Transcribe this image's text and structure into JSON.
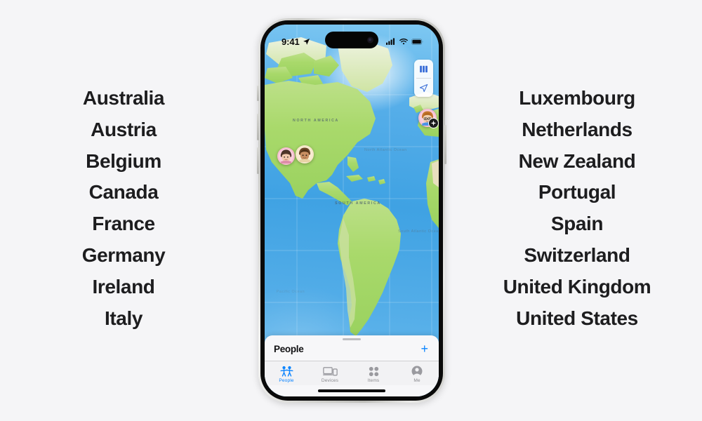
{
  "page": {
    "background_color": "#f5f5f7",
    "accent_color": "#0a84ff"
  },
  "left_column": {
    "name": "countries-left",
    "items": [
      {
        "label": "Australia"
      },
      {
        "label": "Austria"
      },
      {
        "label": "Belgium"
      },
      {
        "label": "Canada"
      },
      {
        "label": "France"
      },
      {
        "label": "Germany"
      },
      {
        "label": "Ireland"
      },
      {
        "label": "Italy"
      }
    ]
  },
  "right_column": {
    "name": "countries-right",
    "items": [
      {
        "label": "Luxembourg"
      },
      {
        "label": "Netherlands"
      },
      {
        "label": "New Zealand"
      },
      {
        "label": "Portugal"
      },
      {
        "label": "Spain"
      },
      {
        "label": "Switzerland"
      },
      {
        "label": "United Kingdom"
      },
      {
        "label": "United States"
      }
    ]
  },
  "phone": {
    "status_bar": {
      "time": "9:41",
      "location_icon": "location-arrow-icon",
      "cellular_icon": "cellular-signal-icon",
      "wifi_icon": "wifi-icon",
      "battery_icon": "battery-icon"
    },
    "map": {
      "land_color": "#a9d96b",
      "ocean_color": "#4aa8e6",
      "labels": [
        {
          "name": "north-america",
          "text": "North America"
        },
        {
          "name": "south-america",
          "text": "South America"
        },
        {
          "name": "north-atlantic-ocean",
          "text": "North Atlantic Ocean"
        },
        {
          "name": "south-atlantic-ocean",
          "text": "South Atlantic Ocean"
        },
        {
          "name": "pacific-ocean",
          "text": "Pacific Ocean"
        }
      ],
      "controls": [
        {
          "name": "map-type-button",
          "icon": "map-layers-icon"
        },
        {
          "name": "recenter-location-button",
          "icon": "location-arrow-icon"
        }
      ],
      "people_pins": [
        {
          "name": "person-pin-1",
          "icon": "memoji-avatar",
          "ring_color": "#f7bdd0"
        },
        {
          "name": "person-pin-2",
          "icon": "memoji-avatar",
          "ring_color": "#f6e7c8"
        },
        {
          "name": "person-pin-3",
          "icon": "memoji-avatar",
          "ring_color": "#f6bcd3",
          "badge": "airplane-badge-icon"
        }
      ]
    },
    "sheet": {
      "title": "People",
      "add_label": "+"
    },
    "tabs": [
      {
        "label": "People",
        "icon": "two-people-icon",
        "active": true
      },
      {
        "label": "Devices",
        "icon": "laptop-phone-icon",
        "active": false
      },
      {
        "label": "Items",
        "icon": "four-dots-icon",
        "active": false
      },
      {
        "label": "Me",
        "icon": "person-circle-icon",
        "active": false
      }
    ]
  }
}
